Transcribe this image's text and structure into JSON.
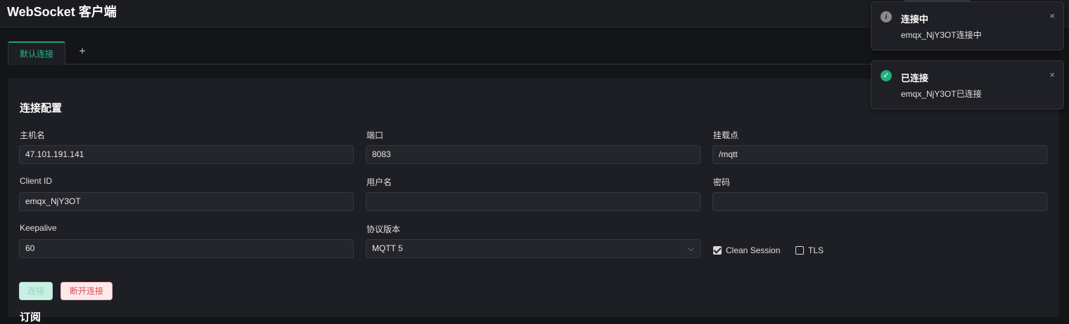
{
  "app": {
    "title": "WebSocket 客户端"
  },
  "tabs": {
    "items": [
      {
        "label": "默认连接"
      }
    ],
    "add_label": "+"
  },
  "config": {
    "section_title": "连接配置",
    "host": {
      "label": "主机名",
      "value": "47.101.191.141"
    },
    "port": {
      "label": "端口",
      "value": "8083"
    },
    "path": {
      "label": "挂载点",
      "value": "/mqtt"
    },
    "client_id": {
      "label": "Client ID",
      "value": "emqx_NjY3OT"
    },
    "username": {
      "label": "用户名",
      "value": ""
    },
    "password": {
      "label": "密码",
      "value": ""
    },
    "keepalive": {
      "label": "Keepalive",
      "value": "60"
    },
    "protocol": {
      "label": "协议版本",
      "value": "MQTT 5"
    },
    "clean_session": {
      "label": "Clean Session",
      "checked": true
    },
    "tls": {
      "label": "TLS",
      "checked": false
    },
    "connect_label": "连接",
    "disconnect_label": "断开连接",
    "next_section_title": "订阅"
  },
  "toasts": [
    {
      "title": "连接中",
      "message": "emqx_NjY3OT连接中",
      "icon": "info-icon",
      "close": "×"
    },
    {
      "title": "已连接",
      "message": "emqx_NjY3OT已连接",
      "icon": "check-circle-icon",
      "close": "×"
    }
  ],
  "colors": {
    "accent": "#1fa37c",
    "danger": "#e04b55",
    "background": "#141517",
    "panel": "#1e1f24"
  }
}
